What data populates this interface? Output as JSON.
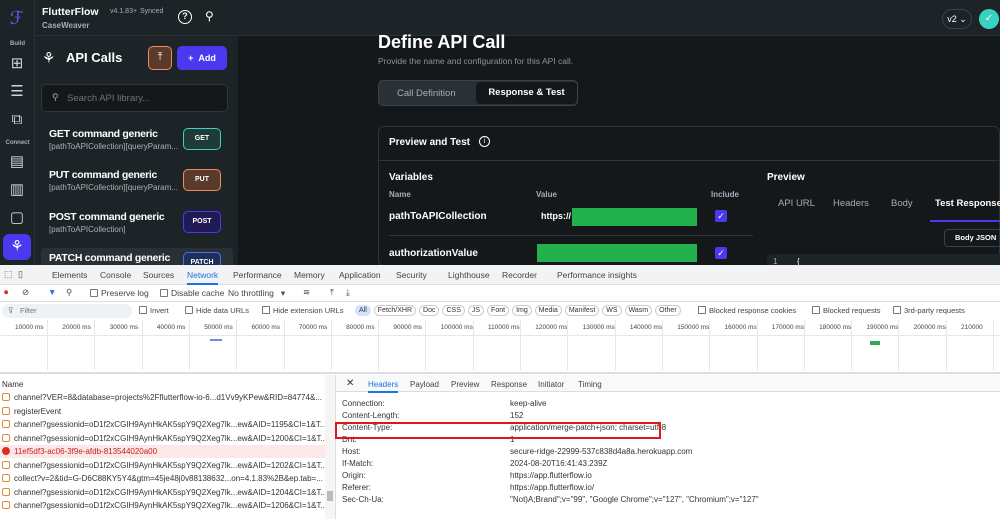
{
  "app": {
    "brand": "FlutterFlow",
    "version": "v4.1.83+",
    "sync": "Synced",
    "project": "CaseWeaver",
    "version_select": "v2"
  },
  "rail": {
    "build_label": "Build",
    "connect_label": "Connect"
  },
  "panel": {
    "title": "API Calls",
    "add_label": "Add",
    "search_placeholder": "Search API library...",
    "items": [
      {
        "name": "GET command generic",
        "path": "[pathToAPICollection][queryParam...",
        "method": "GET"
      },
      {
        "name": "PUT command generic",
        "path": "[pathToAPICollection][queryParam...",
        "method": "PUT"
      },
      {
        "name": "POST command generic",
        "path": "[pathToAPICollection]",
        "method": "POST"
      },
      {
        "name": "PATCH command generic",
        "path": "",
        "method": "PATCH"
      }
    ]
  },
  "main": {
    "title": "Define API Call",
    "subtitle": "Provide the name and configuration for this API call.",
    "tabs": [
      "Call Definition",
      "Response & Test"
    ],
    "card_title": "Preview and Test",
    "variables_title": "Variables",
    "columns": [
      "Name",
      "Value",
      "Include"
    ],
    "variables": [
      {
        "name": "pathToAPICollection",
        "value": "https://"
      },
      {
        "name": "authorizationValue",
        "value": ""
      }
    ],
    "preview_title": "Preview",
    "preview_tabs": [
      "API URL",
      "Headers",
      "Body",
      "Test Response"
    ],
    "body_json": "Body JSON",
    "code_line": "1",
    "code_text": "{"
  },
  "devtools": {
    "tabs": [
      "Elements",
      "Console",
      "Sources",
      "Network",
      "Performance",
      "Memory",
      "Application",
      "Security",
      "Lighthouse",
      "Recorder",
      "Performance insights"
    ],
    "preserve_log": "Preserve log",
    "disable_cache": "Disable cache",
    "throttling": "No throttling",
    "filter_placeholder": "Filter",
    "invert": "Invert",
    "hide_data": "Hide data URLs",
    "hide_ext": "Hide extension URLs",
    "types": [
      "All",
      "Fetch/XHR",
      "Doc",
      "CSS",
      "JS",
      "Font",
      "Img",
      "Media",
      "Manifest",
      "WS",
      "Wasm",
      "Other"
    ],
    "blocked_cookies": "Blocked response cookies",
    "blocked_requests": "Blocked requests",
    "third_party": "3rd-party requests",
    "ticks": [
      "10000 ms",
      "20000 ms",
      "30000 ms",
      "40000 ms",
      "50000 ms",
      "60000 ms",
      "70000 ms",
      "80000 ms",
      "90000 ms",
      "100000 ms",
      "110000 ms",
      "120000 ms",
      "130000 ms",
      "140000 ms",
      "150000 ms",
      "160000 ms",
      "170000 ms",
      "180000 ms",
      "190000 ms",
      "200000 ms",
      "210000"
    ],
    "name_header": "Name",
    "requests": [
      "channel?VER=8&database=projects%2Fflutterflow-io-6...d1Vv9yKPew&RID=84774&...",
      "registerEvent",
      "channel?gsessionid=oD1f2xCGIH9AynHkAK5spY9Q2Xeg7lk...ew&AID=1195&CI=1&T...",
      "channel?gsessionid=oD1f2xCGIH9AynHkAK5spY9Q2Xeg7lk...ew&AID=1200&CI=1&T...",
      "11ef5df3-ac06-3f9e-afdb-813544020a00",
      "channel?gsessionid=oD1f2xCGIH9AynHkAK5spY9Q2Xeg7lk...ew&AID=1202&CI=1&T...",
      "collect?v=2&tid=G-D6C88KY5Y4&gtm=45je48j0v88138632...on=4.1.83%2B&ep.tab=...",
      "channel?gsessionid=oD1f2xCGIH9AynHkAK5spY9Q2Xeg7lk...ew&AID=1204&CI=1&T...",
      "channel?gsessionid=oD1f2xCGIH9AynHkAK5spY9Q2Xeg7lk...ew&AID=1206&CI=1&T..."
    ],
    "detail_tabs": [
      "Headers",
      "Payload",
      "Preview",
      "Response",
      "Initiator",
      "Timing"
    ],
    "headers": [
      {
        "k": "Connection:",
        "v": "keep-alive"
      },
      {
        "k": "Content-Length:",
        "v": "152"
      },
      {
        "k": "Content-Type:",
        "v": "application/merge-patch+json; charset=utf-8"
      },
      {
        "k": "Dnt:",
        "v": "1"
      },
      {
        "k": "Host:",
        "v": "secure-ridge-22999-537c838d4a8a.herokuapp.com"
      },
      {
        "k": "If-Match:",
        "v": "2024-08-20T16:41:43.239Z"
      },
      {
        "k": "Origin:",
        "v": "https://app.flutterflow.io"
      },
      {
        "k": "Referer:",
        "v": "https://app.flutterflow.io/"
      },
      {
        "k": "Sec-Ch-Ua:",
        "v": "\"Not)A;Brand\";v=\"99\", \"Google Chrome\";v=\"127\", \"Chromium\";v=\"127\""
      }
    ]
  },
  "colors": {
    "accent": "#4b39ef",
    "get": "#39d2c0",
    "put": "#ee8b60",
    "redacted": "#22b14c",
    "highlight": "#e0161b"
  }
}
